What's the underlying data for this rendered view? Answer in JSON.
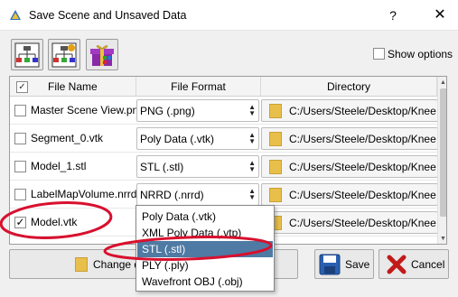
{
  "window": {
    "title": "Save Scene and Unsaved Data",
    "help": "?",
    "close": "✕"
  },
  "toolbar": {
    "icon1": "mrml-scene-icon",
    "icon2": "mrml-scene-modified-icon",
    "icon3": "data-bundle-icon"
  },
  "show_options": {
    "label": "Show options",
    "checked": false
  },
  "table": {
    "headers": {
      "name": "File Name",
      "format": "File Format",
      "directory": "Directory"
    },
    "rows": [
      {
        "checked": false,
        "name": "Master Scene View.png",
        "format": "PNG (.png)",
        "directory": "C:/Users/Steele/Desktop/Knee wo"
      },
      {
        "checked": false,
        "name": "Segment_0.vtk",
        "format": "Poly Data (.vtk)",
        "directory": "C:/Users/Steele/Desktop/Knee wo"
      },
      {
        "checked": false,
        "name": "Model_1.stl",
        "format": "STL (.stl)",
        "directory": "C:/Users/Steele/Desktop/Knee wo"
      },
      {
        "checked": false,
        "name": "LabelMapVolume.nrrd",
        "format": "NRRD (.nrrd)",
        "directory": "C:/Users/Steele/Desktop/Knee wo"
      },
      {
        "checked": true,
        "name": "Model.vtk",
        "format": "",
        "directory": "C:/Users/Steele/Desktop/Knee wo"
      }
    ]
  },
  "dropdown": {
    "options": [
      "Poly Data (.vtk)",
      "XML Poly Data (.vtp)",
      "STL (.stl)",
      "PLY (.ply)",
      "Wavefront OBJ (.obj)"
    ],
    "selected": 2
  },
  "buttons": {
    "change_dir": "Change di",
    "save": "Save",
    "cancel": "Cancel"
  },
  "colors": {
    "annotation": "#d8102e",
    "selection": "#4e7aa3"
  }
}
